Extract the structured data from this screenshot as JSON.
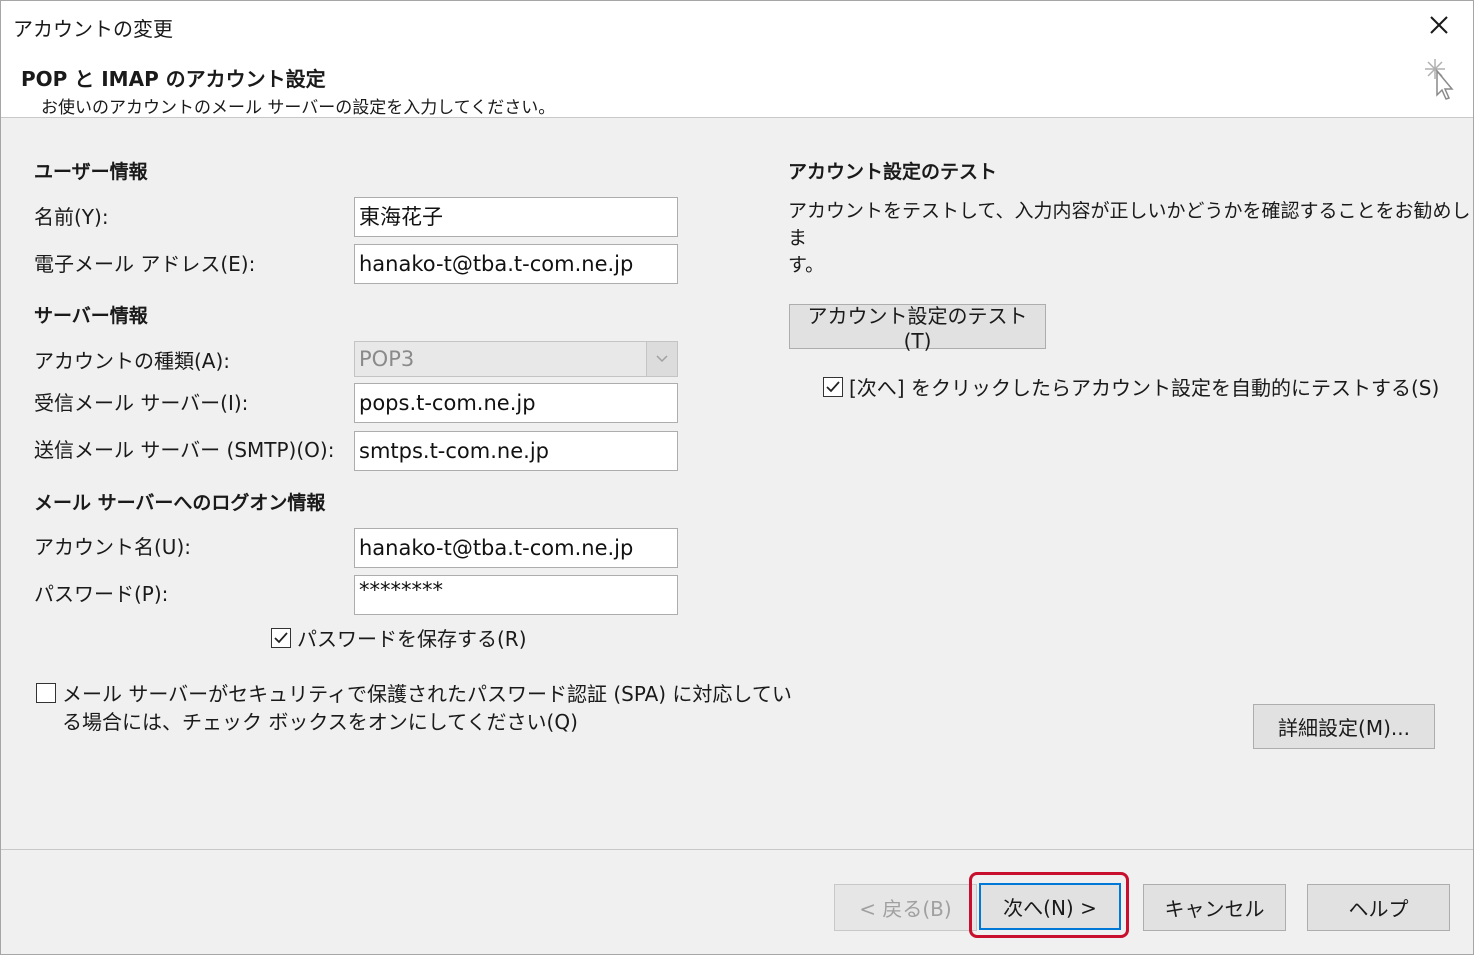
{
  "window": {
    "title": "アカウントの変更"
  },
  "header": {
    "title": "POP と IMAP のアカウント設定",
    "subtitle": "お使いのアカウントのメール サーバーの設定を入力してください。"
  },
  "user_info": {
    "section_title": "ユーザー情報",
    "name_label": "名前(Y):",
    "name_value": "東海花子",
    "email_label": "電子メール アドレス(E):",
    "email_value": "hanako-t@tba.t-com.ne.jp"
  },
  "server_info": {
    "section_title": "サーバー情報",
    "account_type_label": "アカウントの種類(A):",
    "account_type_value": "POP3",
    "incoming_label": "受信メール サーバー(I):",
    "incoming_value": "pops.t-com.ne.jp",
    "outgoing_label": "送信メール サーバー (SMTP)(O):",
    "outgoing_value": "smtps.t-com.ne.jp"
  },
  "logon_info": {
    "section_title": "メール サーバーへのログオン情報",
    "account_name_label": "アカウント名(U):",
    "account_name_value": "hanako-t@tba.t-com.ne.jp",
    "password_label": "パスワード(P):",
    "password_value": "********",
    "save_password_label": "パスワードを保存する(R)",
    "save_password_checked": true,
    "spa_label_line1": "メール サーバーがセキュリティで保護されたパスワード認証 (SPA) に対応してい",
    "spa_label_line2": "る場合には、チェック ボックスをオンにしてください(Q)",
    "spa_checked": false
  },
  "test_panel": {
    "section_title": "アカウント設定のテスト",
    "description_line1": "アカウントをテストして、入力内容が正しいかどうかを確認することをお勧めしま",
    "description_line2": "す。",
    "test_button": "アカウント設定のテスト(T)",
    "auto_test_label": "[次へ] をクリックしたらアカウント設定を自動的にテストする(S)",
    "auto_test_checked": true,
    "advanced_button": "詳細設定(M)..."
  },
  "footer": {
    "back_button": "< 戻る(B)",
    "next_button": "次へ(N) >",
    "cancel_button": "キャンセル",
    "help_button": "ヘルプ"
  },
  "colors": {
    "highlight": "#c8102e",
    "default_button_border": "#0078d7"
  }
}
